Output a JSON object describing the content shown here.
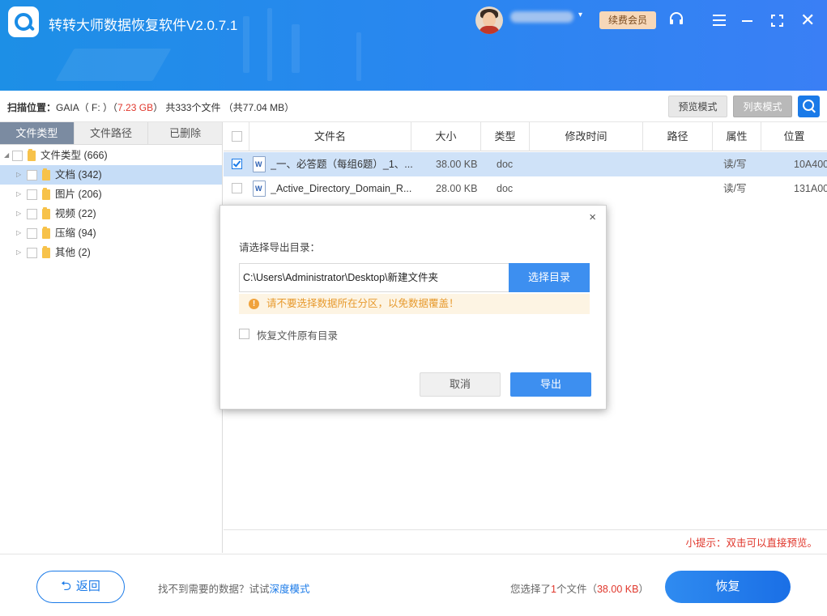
{
  "header": {
    "app_title": "转转大师数据恢复软件V2.0.7.1",
    "vip_label": "续费会员",
    "user_caret": "▾",
    "icons": [
      "logo-icon",
      "avatar",
      "chevron-down-icon",
      "headset-icon",
      "menu-icon",
      "minimize-icon",
      "maximize-icon",
      "close-icon"
    ]
  },
  "scanbar": {
    "location_label": "扫描位置：",
    "location_value": "GAIA（ F: ）",
    "size": "7.23 GB",
    "summary": "共333个文件 （共77.04 MB）",
    "preview_mode": "预览模式",
    "list_mode": "列表模式"
  },
  "left_tabs": [
    "文件类型",
    "文件路径",
    "已删除"
  ],
  "tree": {
    "root": "文件类型 (666)",
    "items": [
      "文档 (342)",
      "图片 (206)",
      "视频 (22)",
      "压缩 (94)",
      "其他 (2)"
    ]
  },
  "table": {
    "columns": [
      "文件名",
      "大小",
      "类型",
      "修改时间",
      "路径",
      "属性",
      "位置"
    ],
    "rows": [
      {
        "name": "_一、必答题（每组6题）_1、...",
        "size": "38.00 KB",
        "type": "doc",
        "modified": "",
        "path": "",
        "attr": "读/写",
        "pos": "10A400",
        "checked": true
      },
      {
        "name": "_Active_Directory_Domain_R...",
        "size": "28.00 KB",
        "type": "doc",
        "modified": "",
        "path": "",
        "attr": "读/写",
        "pos": "131A00",
        "checked": false
      }
    ],
    "tip": "小提示：双击可以直接预览。"
  },
  "footer": {
    "back_label": "返回",
    "hint_prefix": "找不到需要的数据？试试",
    "hint_link": "深度模式",
    "selected_prefix": "您选择了",
    "selected_count": "1",
    "selected_mid": "个文件（",
    "selected_size": "38.00 KB",
    "selected_suffix": "）",
    "recover_label": "恢复"
  },
  "dialog": {
    "close": "×",
    "label": "请选择导出目录：",
    "path_value": "C:\\Users\\Administrator\\Desktop\\新建文件夹",
    "choose_label": "选择目录",
    "warning": "请不要选择数据所在分区，以免数据覆盖！",
    "keep_dir_label": "恢复文件原有目录",
    "cancel_label": "取消",
    "export_label": "导出"
  }
}
